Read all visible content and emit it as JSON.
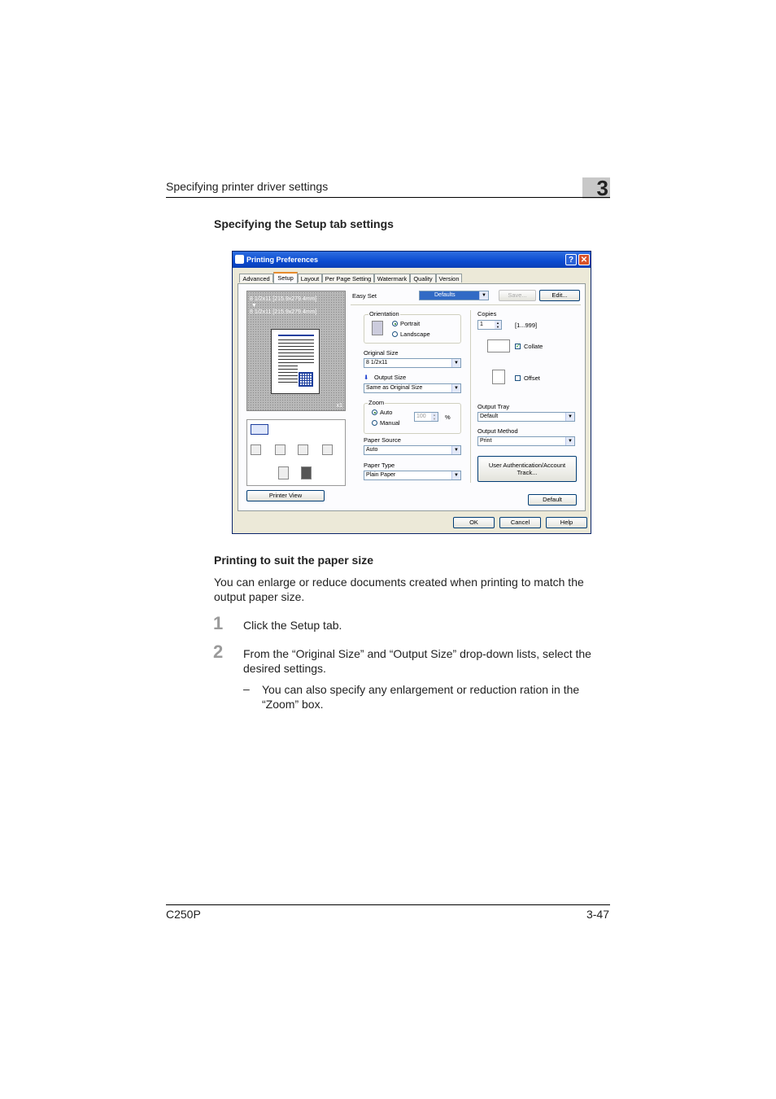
{
  "header": {
    "section_title": "Specifying printer driver settings",
    "chapter_number": "3"
  },
  "section_heading": "Specifying the Setup tab settings",
  "dialog": {
    "title": "Printing Preferences",
    "title_buttons": {
      "help": "?",
      "close": "✕"
    },
    "tabs": [
      "Advanced",
      "Setup",
      "Layout",
      "Per Page Setting",
      "Watermark",
      "Quality",
      "Version"
    ],
    "active_tab": "Setup",
    "preview": {
      "line1": "8 1/2x11 [215.9x279.4mm]",
      "arrow": "▼",
      "line2": "8 1/2x11 [215.9x279.4mm]",
      "scale": "x1"
    },
    "printer_view_button": "Printer View",
    "easy_set": {
      "label": "Easy Set",
      "value": "Defaults",
      "save_button": "Save...",
      "edit_button": "Edit..."
    },
    "orientation": {
      "label": "Orientation",
      "portrait": "Portrait",
      "landscape": "Landscape"
    },
    "original_size": {
      "label": "Original Size",
      "value": "8 1/2x11"
    },
    "output_size": {
      "label": "Output Size",
      "value": "Same as Original Size"
    },
    "zoom": {
      "label": "Zoom",
      "auto": "Auto",
      "manual": "Manual",
      "value": "100",
      "unit": "%"
    },
    "paper_source": {
      "label": "Paper Source",
      "value": "Auto"
    },
    "paper_type": {
      "label": "Paper Type",
      "value": "Plain Paper"
    },
    "copies": {
      "label": "Copies",
      "value": "1",
      "range": "[1...999]",
      "collate": "Collate",
      "offset": "Offset"
    },
    "output_tray": {
      "label": "Output Tray",
      "value": "Default"
    },
    "output_method": {
      "label": "Output Method",
      "value": "Print"
    },
    "auth_button": {
      "line1": "User Authentication/Account",
      "line2": "Track..."
    },
    "default_button": "Default",
    "footer_buttons": {
      "ok": "OK",
      "cancel": "Cancel",
      "help": "Help"
    }
  },
  "subheading": "Printing to suit the paper size",
  "intro": "You can enlarge or reduce documents created when printing to match the output paper size.",
  "steps": [
    {
      "num": "1",
      "text": "Click the Setup tab."
    },
    {
      "num": "2",
      "text": "From the “Original Size” and “Output Size” drop-down lists, select the desired settings."
    }
  ],
  "substep": {
    "dash": "–",
    "text": "You can also specify any enlargement or reduction ration in the “Zoom” box."
  },
  "footer": {
    "model": "C250P",
    "page": "3-47"
  }
}
